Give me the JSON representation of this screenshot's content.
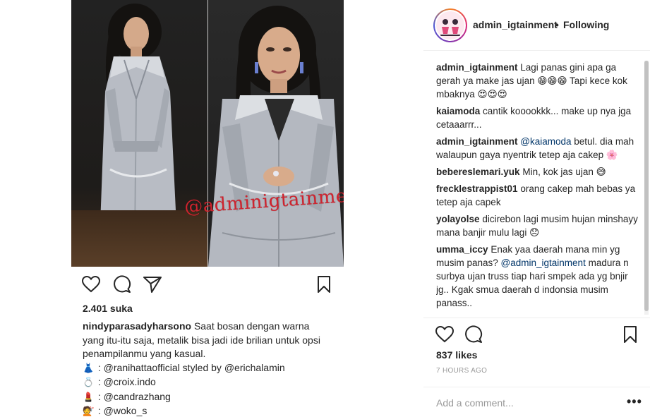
{
  "left_post": {
    "watermark": "@adminigtainment",
    "likes": "2.401 suka",
    "caption_user": "nindyparasadyharsono",
    "caption_text": "Saat bosan dengan warna yang itu-itu saja, metalik bisa jadi ide brilian untuk opsi penampilanmu yang kasual.",
    "credits": [
      {
        "icon": "dress-icon",
        "glyph": "👗",
        "sep": " : ",
        "handle": "@ranihattaofficial",
        "mid": " styled by ",
        "handle2": "@erichalamin"
      },
      {
        "icon": "ring-icon",
        "glyph": "💍",
        "sep": " : ",
        "handle": "@croix.indo",
        "mid": "",
        "handle2": ""
      },
      {
        "icon": "lipstick-icon",
        "glyph": "💄",
        "sep": " : ",
        "handle": "@candrazhang",
        "mid": "",
        "handle2": ""
      },
      {
        "icon": "haircut-icon",
        "glyph": "💇",
        "sep": " : ",
        "handle": "@woko_s",
        "mid": "",
        "handle2": ""
      }
    ]
  },
  "right_panel": {
    "username": "admin_igtainment",
    "separator": "•",
    "follow_status": "Following",
    "comments": [
      {
        "user": "admin_igtainment",
        "parts": [
          {
            "t": "text",
            "v": "Lagi panas gini apa ga gerah ya make jas ujan 😁😁😁 Tapi kece kok mbaknya 😍😍😍"
          }
        ]
      },
      {
        "user": "kaiamoda",
        "parts": [
          {
            "t": "text",
            "v": "cantik kooookkk... make up nya jga cetaaarrr..."
          }
        ]
      },
      {
        "user": "admin_igtainment",
        "parts": [
          {
            "t": "mention",
            "v": "@kaiamoda"
          },
          {
            "t": "text",
            "v": " betul. dia mah walaupun gaya nyentrik tetep aja cakep 🌸"
          }
        ]
      },
      {
        "user": "bebereslemari.yuk",
        "parts": [
          {
            "t": "text",
            "v": "Min, kok jas ujan 😅"
          }
        ]
      },
      {
        "user": "frecklestrappist01",
        "parts": [
          {
            "t": "text",
            "v": "orang cakep mah bebas ya tetep aja capek"
          }
        ]
      },
      {
        "user": "yolayolse",
        "parts": [
          {
            "t": "text",
            "v": "dicirebon lagi musim hujan minshayy mana banjir mulu lagi 😞"
          }
        ]
      },
      {
        "user": "umma_iccy",
        "parts": [
          {
            "t": "text",
            "v": "Enak yaa daerah mana min yg musim panas? "
          },
          {
            "t": "mention",
            "v": "@admin_igtainment"
          },
          {
            "t": "text",
            "v": " madura n surbya ujan truss tiap hari smpek ada yg bnjir jg.. Kgak smua daerah d indonsia musim panass.."
          }
        ]
      }
    ],
    "likes": "837 likes",
    "time_ago": "7 HOURS AGO",
    "add_comment_placeholder": "Add a comment...",
    "more_label": "•••"
  },
  "colors": {
    "text": "#262626",
    "muted": "#999999",
    "watermark": "#d0232e",
    "mention": "#003569",
    "border": "#efefef"
  }
}
